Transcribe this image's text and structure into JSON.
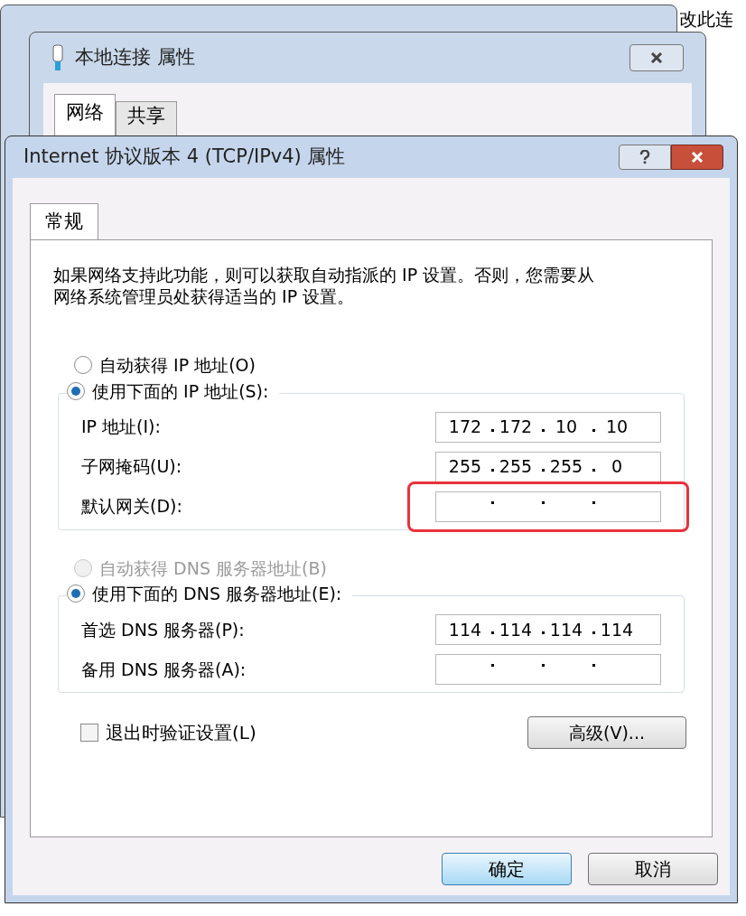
{
  "background_windows": [
    {
      "title": "本地连接 属性",
      "tabs": [
        {
          "label": "网络",
          "selected": true
        },
        {
          "label": "共享",
          "selected": false
        }
      ]
    }
  ],
  "background_text": "改此连",
  "window": {
    "title": "Internet 协议版本 4 (TCP/IPv4) 属性"
  },
  "tabs": [
    {
      "label": "常规",
      "selected": true
    }
  ],
  "description": "如果网络支持此功能，则可以获取自动指派的 IP 设置。否则，您需要从网络系统管理员处获得适当的 IP 设置。",
  "sections": [
    {
      "options": [
        {
          "label": "自动获得 IP 地址(O)",
          "selected": false,
          "disabled": false
        },
        {
          "label": "使用下面的 IP 地址(S):",
          "selected": true,
          "disabled": false
        }
      ],
      "fields": [
        {
          "label": "IP 地址(I):",
          "octets": [
            "172",
            "172",
            "10",
            "10"
          ],
          "highlight": false
        },
        {
          "label": "子网掩码(U):",
          "octets": [
            "255",
            "255",
            "255",
            "0"
          ],
          "highlight": false
        },
        {
          "label": "默认网关(D):",
          "highlight": true
        }
      ]
    },
    {
      "options": [
        {
          "label": "自动获得 DNS 服务器地址(B)",
          "selected": false,
          "disabled": true
        },
        {
          "label": "使用下面的 DNS 服务器地址(E):",
          "selected": true,
          "disabled": false
        }
      ],
      "fields": [
        {
          "label": "首选 DNS 服务器(P):",
          "octets": [
            "114",
            "114",
            "114",
            "114"
          ],
          "highlight": false
        },
        {
          "label": "备用 DNS 服务器(A):",
          "highlight": false
        }
      ]
    }
  ],
  "validate_checkbox": {
    "label": "退出时验证设置(L)",
    "checked": false
  },
  "advanced_button": "高级(V)...",
  "buttons": [
    {
      "label": "确定",
      "selected": true
    },
    {
      "label": "取消",
      "selected": false
    }
  ]
}
